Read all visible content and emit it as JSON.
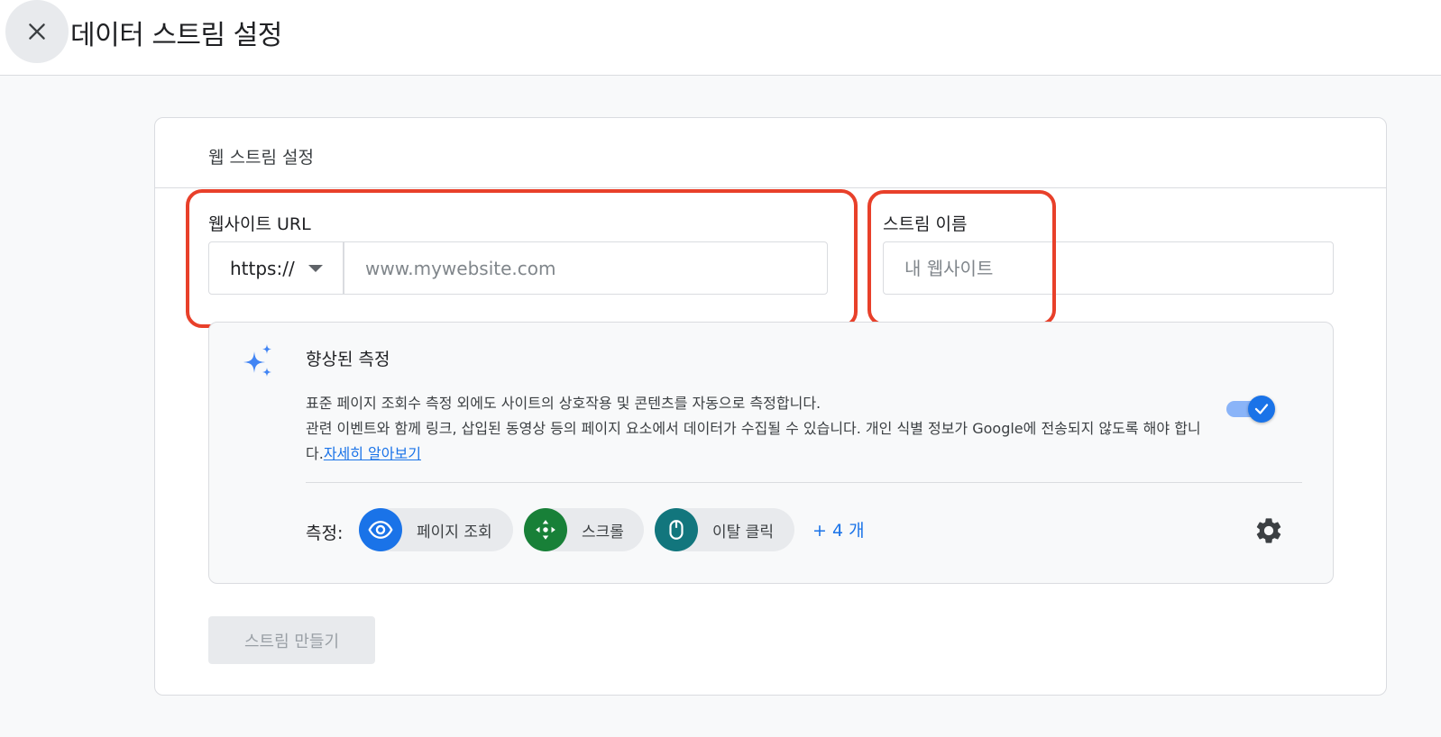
{
  "header": {
    "title": "데이터 스트림 설정",
    "close_icon": "close-icon"
  },
  "card": {
    "title": "웹 스트림 설정",
    "url_field": {
      "label": "웹사이트 URL",
      "protocol_value": "https://",
      "placeholder": "www.mywebsite.com",
      "value": ""
    },
    "name_field": {
      "label": "스트림 이름",
      "placeholder": "내 웹사이트",
      "value": ""
    },
    "enhanced_measurement": {
      "icon": "sparkle-icon",
      "title": "향상된 측정",
      "description_line1": "표준 페이지 조회수 측정 외에도 사이트의 상호작용 및 콘텐츠를 자동으로 측정합니다.",
      "description_line2": "관련 이벤트와 함께 링크, 삽입된 동영상 등의 페이지 요소에서 데이터가 수집될 수 있습니다. 개인 식별 정보가 Google에 전송되지 않도록 해야 합니다.",
      "learn_more": "자세히 알아보기",
      "toggle_on": true,
      "measurement_label": "측정:",
      "chips": [
        {
          "label": "페이지 조회",
          "icon": "eye-icon",
          "color": "#1a73e8"
        },
        {
          "label": "스크롤",
          "icon": "scroll-arrows-icon",
          "color": "#188038"
        },
        {
          "label": "이탈 클릭",
          "icon": "mouse-icon",
          "color": "#12767d"
        }
      ],
      "more_label": "+ 4 개",
      "settings_icon": "gear-icon"
    },
    "create_button": "스트림 만들기"
  },
  "colors": {
    "accent": "#1a73e8",
    "highlight": "#e8402a"
  }
}
